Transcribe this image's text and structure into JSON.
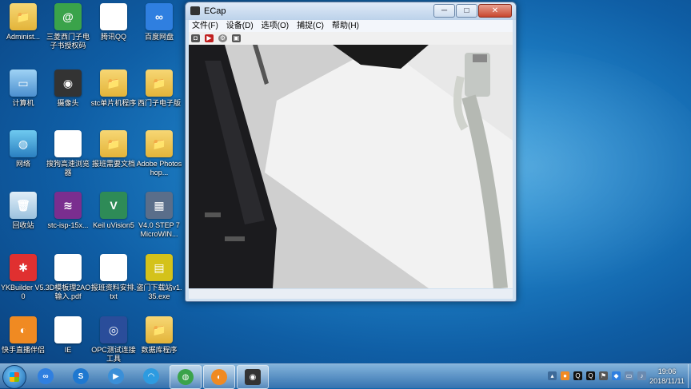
{
  "desktop": {
    "icons": [
      {
        "label": "Administ...",
        "glyph": "📁"
      },
      {
        "label": "三菱西门子电子书授权码",
        "glyph": "@"
      },
      {
        "label": "腾讯QQ",
        "glyph": "Q"
      },
      {
        "label": "百度网盘",
        "glyph": "∞"
      },
      {
        "label": "计算机",
        "glyph": "▭"
      },
      {
        "label": "摄像头",
        "glyph": "◉"
      },
      {
        "label": "stc单片机程序",
        "glyph": "📁"
      },
      {
        "label": "西门子电子版",
        "glyph": "📁"
      },
      {
        "label": "网络",
        "glyph": "◍"
      },
      {
        "label": "搜狗高速浏览器",
        "glyph": "S"
      },
      {
        "label": "报班需要文档",
        "glyph": "📁"
      },
      {
        "label": "Adobe Photoshop...",
        "glyph": "📁"
      },
      {
        "label": "回收站",
        "glyph": "🗑"
      },
      {
        "label": "stc-isp-15x...",
        "glyph": "≋"
      },
      {
        "label": "Keil uVision5",
        "glyph": "V"
      },
      {
        "label": "V4.0 STEP 7 MicroWIN...",
        "glyph": "▦"
      },
      {
        "label": "YKBuilder V5.0",
        "glyph": "✱"
      },
      {
        "label": "3D模板理2AO输入.pdf",
        "glyph": "A"
      },
      {
        "label": "报班资料安排.txt",
        "glyph": "≡"
      },
      {
        "label": "盗门下载站v1.35.exe",
        "glyph": "▤"
      },
      {
        "label": "快手直播伴侣",
        "glyph": "◐"
      },
      {
        "label": "IE",
        "glyph": "e"
      },
      {
        "label": "OPC测试连接工具",
        "glyph": "◎"
      },
      {
        "label": "数据库程序",
        "glyph": "📁"
      }
    ]
  },
  "window": {
    "title": "ECap",
    "buttons": {
      "minimize": "─",
      "maximize": "□",
      "close": "✕"
    },
    "menu": [
      "文件(F)",
      "设备(D)",
      "选项(O)",
      "捕捉(C)",
      "帮助(H)"
    ],
    "toolbar": [
      {
        "name": "snapshot-icon",
        "glyph": "◘"
      },
      {
        "name": "record-icon",
        "glyph": "▶"
      },
      {
        "name": "settings-icon",
        "glyph": "⚙"
      },
      {
        "name": "image-icon",
        "glyph": "▣"
      }
    ]
  },
  "taskbar": {
    "apps": [
      {
        "name": "baidu-netdisk",
        "glyph": "∞",
        "color": "#2f7fe0"
      },
      {
        "name": "sogou-browser",
        "glyph": "S",
        "color": "#1e78d0"
      },
      {
        "name": "media-player",
        "glyph": "▶",
        "color": "#3a8fd8"
      },
      {
        "name": "weather-app",
        "glyph": "◠",
        "color": "#2d9be0"
      },
      {
        "name": "network-app",
        "glyph": "◍",
        "color": "#3aa34a"
      },
      {
        "name": "kuaishou-live",
        "glyph": "◐",
        "color": "#f08a22"
      },
      {
        "name": "ecap-camera",
        "glyph": "◉",
        "color": "#333333"
      }
    ],
    "tray": [
      {
        "name": "tray-expand-icon",
        "glyph": "▴",
        "color": "#3d6a99"
      },
      {
        "name": "tray-orange-icon",
        "glyph": "●",
        "color": "#f08a22"
      },
      {
        "name": "tray-qq-icon",
        "glyph": "Q",
        "color": "#111111"
      },
      {
        "name": "tray-qq2-icon",
        "glyph": "Q",
        "color": "#111111"
      },
      {
        "name": "tray-flag-icon",
        "glyph": "⚑",
        "color": "#555555"
      },
      {
        "name": "tray-shield-icon",
        "glyph": "◆",
        "color": "#2f7fe0"
      },
      {
        "name": "tray-monitor-icon",
        "glyph": "▭",
        "color": "#6a8ab0"
      },
      {
        "name": "tray-volume-icon",
        "glyph": "♪",
        "color": "#6a8ab0"
      }
    ],
    "clock": {
      "time": "19:06",
      "date": "2018/11/11"
    }
  }
}
